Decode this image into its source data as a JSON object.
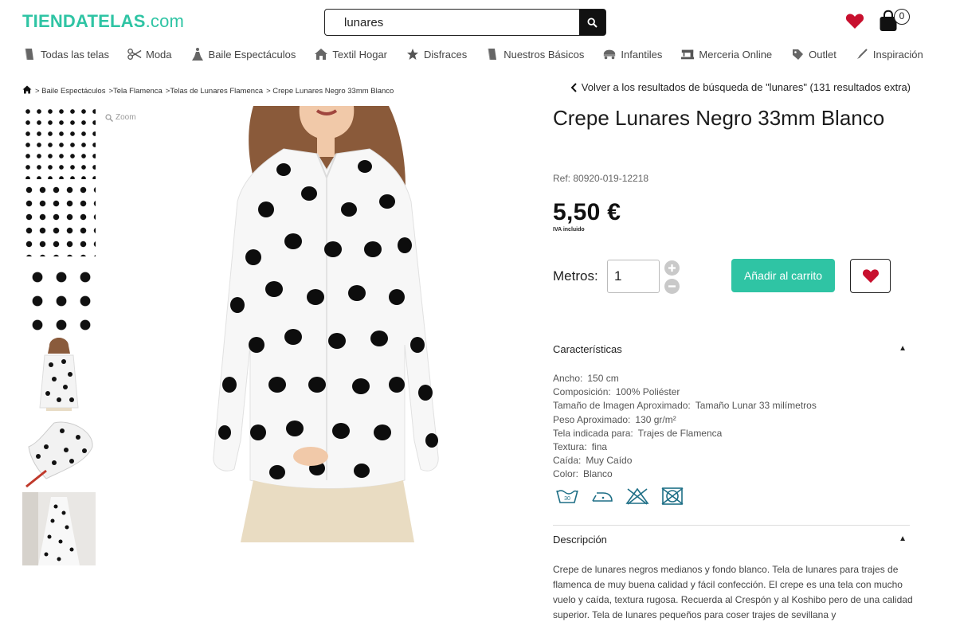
{
  "header": {
    "logo_main": "TIENDATELAS",
    "logo_suffix": ".com",
    "search_value": "lunares",
    "cart_count": "0",
    "accent_color": "#2fc4a4"
  },
  "nav": {
    "items": [
      {
        "label": "Todas las telas",
        "icon": "fabric-icon"
      },
      {
        "label": "Moda",
        "icon": "scissors-icon"
      },
      {
        "label": "Baile Espectáculos",
        "icon": "dancer-icon"
      },
      {
        "label": "Textil Hogar",
        "icon": "house-icon"
      },
      {
        "label": "Disfraces",
        "icon": "star-icon"
      },
      {
        "label": "Nuestros Básicos",
        "icon": "fabric-icon"
      },
      {
        "label": "Infantiles",
        "icon": "baby-icon"
      },
      {
        "label": "Merceria Online",
        "icon": "sewing-machine-icon"
      },
      {
        "label": "Outlet",
        "icon": "tag-icon"
      },
      {
        "label": "Inspiración",
        "icon": "brush-icon"
      }
    ]
  },
  "breadcrumb": {
    "items": [
      "> Baile Espectáculos",
      ">Tela Flamenca",
      ">Telas de Lunares Flamenca",
      "> Crepe Lunares Negro 33mm Blanco"
    ]
  },
  "back_link": "Volver a los resultados de búsqueda de \"lunares\" (131 resultados extra)",
  "zoom_label": "Zoom",
  "product": {
    "title": "Crepe Lunares Negro 33mm Blanco",
    "ref": "Ref: 80920-019-12218",
    "price": "5,50 €",
    "iva": "IVA incluido",
    "metros_label": "Metros:",
    "quantity": "1",
    "add_to_cart": "Añadir al carrito"
  },
  "characteristics": {
    "heading": "Características",
    "rows": [
      {
        "label": "Ancho:",
        "value": "150 cm"
      },
      {
        "label": "Composición:",
        "value": "100% Poliéster"
      },
      {
        "label": "Tamaño de Imagen Aproximado:",
        "value": "Tamaño Lunar 33 milímetros"
      },
      {
        "label": "Peso Aproximado:",
        "value": "130 gr/m²"
      },
      {
        "label": "Tela indicada para:",
        "value": "Trajes de Flamenca"
      },
      {
        "label": "Textura:",
        "value": "fina"
      },
      {
        "label": "Caída:",
        "value": "Muy Caído"
      },
      {
        "label": "Color:",
        "value": "Blanco"
      }
    ],
    "care_icons": [
      "wash-30-icon",
      "iron-low-icon",
      "no-bleach-icon",
      "no-tumble-dry-icon"
    ],
    "care_wash_temp": "30"
  },
  "description": {
    "heading": "Descripción",
    "text": "Crepe de lunares negros medianos y fondo blanco. Tela de lunares para trajes de flamenca de muy buena calidad y fácil confección. El crepe es una tela con mucho vuelo y caída, textura rugosa. Recuerda al Crespón y al Koshibo pero de una calidad superior. Tela de lunares pequeños para coser trajes de sevillana y"
  }
}
